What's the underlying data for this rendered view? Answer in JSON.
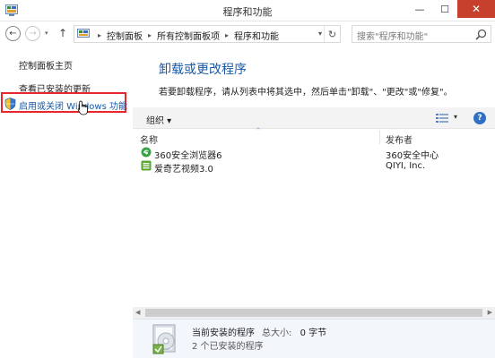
{
  "window": {
    "title": "程序和功能",
    "minimize_glyph": "—",
    "maximize_glyph": "☐",
    "close_glyph": "✕"
  },
  "nav": {
    "back_glyph": "←",
    "forward_glyph": "→",
    "up_glyph": "↑",
    "history_glyph": "▾"
  },
  "address": {
    "crumbs": [
      "控制面板",
      "所有控制面板项",
      "程序和功能"
    ],
    "sep_glyph": "▸",
    "dropdown_glyph": "▾",
    "refresh_glyph": "↻"
  },
  "search": {
    "placeholder": "搜索\"程序和功能\""
  },
  "sidebar": {
    "items": [
      {
        "label": "控制面板主页"
      },
      {
        "label": "查看已安装的更新"
      },
      {
        "label": "启用或关闭 Windows 功能"
      }
    ]
  },
  "main": {
    "heading": "卸载或更改程序",
    "description": "若要卸载程序，请从列表中将其选中，然后单击\"卸载\"、\"更改\"或\"修复\"。"
  },
  "toolbar": {
    "organize_label": "组织 ▾",
    "view_dropdown_glyph": "▾",
    "help_glyph": "?"
  },
  "list": {
    "columns": [
      "名称",
      "发布者"
    ],
    "sort_glyph": "^",
    "rows": [
      {
        "name": "360安全浏览器6",
        "publisher": "360安全中心",
        "icon": "360-browser-icon",
        "icon_color": "#3aa34a"
      },
      {
        "name": "爱奇艺视频3.0",
        "publisher": "QIYI, Inc.",
        "icon": "iqiyi-icon",
        "icon_color": "#5aa832"
      }
    ]
  },
  "scrollbar": {
    "left_glyph": "◀",
    "right_glyph": "▶"
  },
  "details": {
    "title": "当前安装的程序",
    "size_label": "总大小:",
    "size_value": "0 字节",
    "count_text": "2 个已安装的程序"
  },
  "colors": {
    "accent_blue": "#1a5aa6",
    "highlight_red": "#e8262b",
    "close_red": "#c7402c"
  }
}
